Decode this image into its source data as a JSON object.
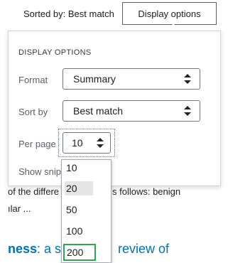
{
  "toolbar": {
    "sorted_label": "Sorted by: Best match",
    "display_options_label": "Display options"
  },
  "panel": {
    "title": "DISPLAY OPTIONS",
    "format_label": "Format",
    "format_value": "Summary",
    "sort_label": "Sort by",
    "sort_value": "Best match",
    "per_page_label": "Per page",
    "per_page_value": "10",
    "show_snippets_label": "Show snip"
  },
  "per_page_options": [
    "10",
    "20",
    "50",
    "100",
    "200"
  ],
  "background": {
    "line1_a": "of the differe",
    "line1_b": "s follows: benign",
    "line2": "ılar ...",
    "title_a_bold": "ness",
    "title_a_rest": ": a sy",
    "title_b": "review of"
  },
  "colors": {
    "link": "#0071bc",
    "highlight_border": "#2fa84f",
    "selected_option_bg": "#e6e6e6"
  }
}
